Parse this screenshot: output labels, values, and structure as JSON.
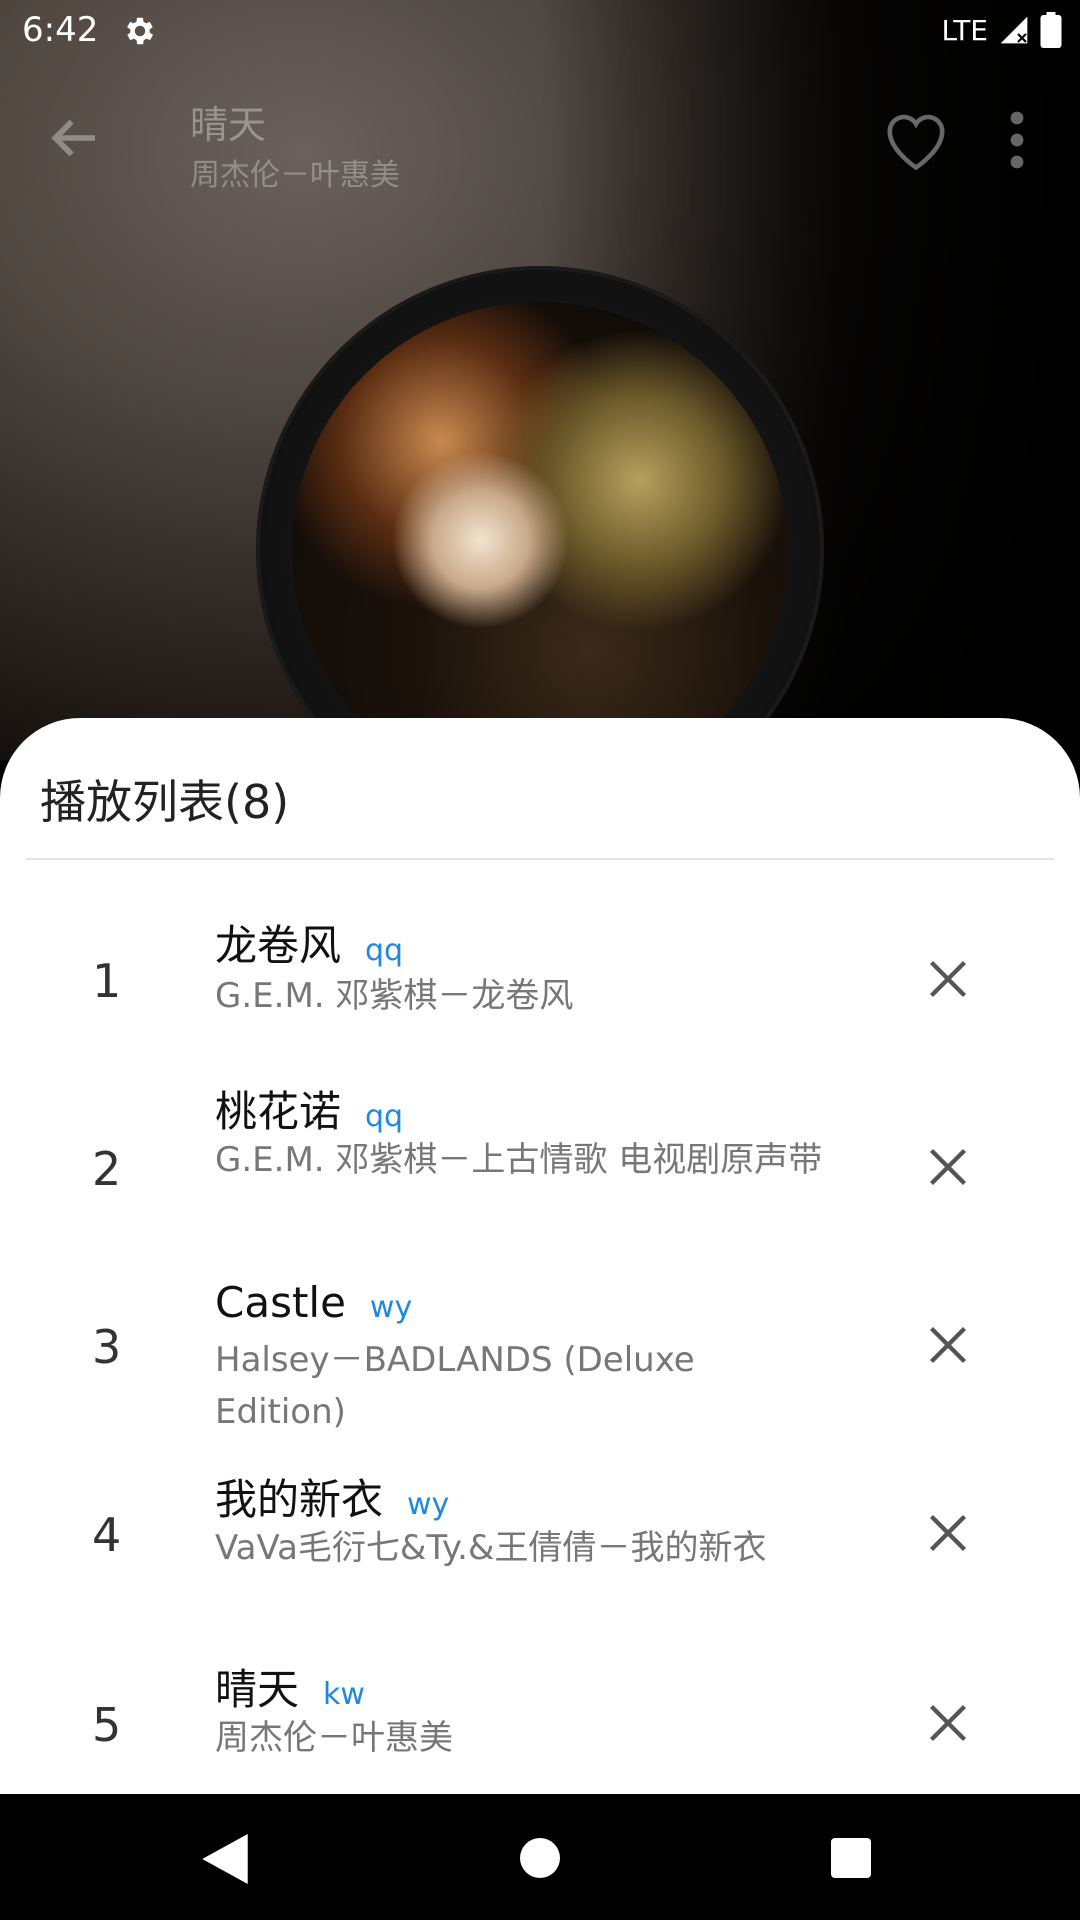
{
  "status_bar": {
    "time": "6:42",
    "network": "LTE",
    "icons": [
      "settings-icon",
      "signal-icon",
      "battery-icon"
    ]
  },
  "toolbar": {
    "title": "晴天",
    "subtitle": "周杰伦－叶惠美",
    "icons": [
      "back-arrow-icon",
      "heart-outline-icon",
      "more-vert-icon"
    ]
  },
  "playlist": {
    "title": "播放列表(8)",
    "items": [
      {
        "index": "1",
        "title": "龙卷风",
        "source": "qq",
        "artist_album": "G.E.M. 邓紫棋－龙卷风"
      },
      {
        "index": "2",
        "title": "桃花诺",
        "source": "qq",
        "artist_album": "G.E.M. 邓紫棋－上古情歌 电视剧原声带"
      },
      {
        "index": "3",
        "title": "Castle",
        "source": "wy",
        "artist_album": "Halsey－BADLANDS (Deluxe Edition)"
      },
      {
        "index": "4",
        "title": "我的新衣",
        "source": "wy",
        "artist_album": "VaVa毛衍七&Ty.&王倩倩－我的新衣"
      },
      {
        "index": "5",
        "title": "晴天",
        "source": "kw",
        "artist_album": "周杰伦－叶惠美"
      }
    ]
  },
  "colors": {
    "source_tag": "#1e88e5",
    "sheet_bg": "#ffffff",
    "artist_text": "#777777"
  },
  "nav_bar": {
    "icons": [
      "nav-back-icon",
      "nav-home-icon",
      "nav-recents-icon"
    ]
  }
}
